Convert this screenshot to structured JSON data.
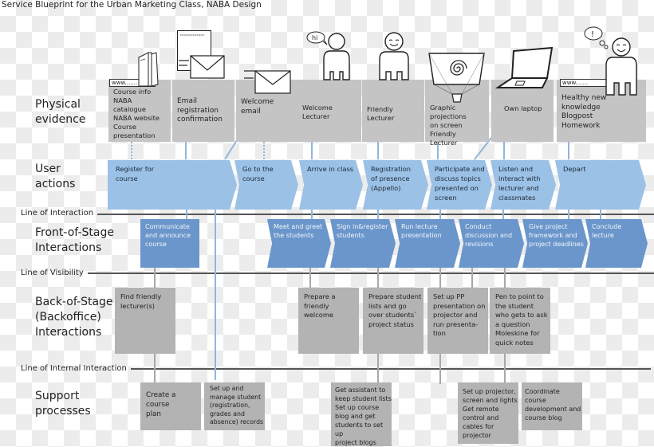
{
  "title": "Service Blueprint for the Urban Marketing Class, NABA Design",
  "lanes": {
    "physical_evidence": "Physical\nevidence",
    "user_actions": "User\nactions",
    "front_stage": "Front-of-Stage\nInteractions",
    "back_stage": "Back-of-Stage\n(Backoffice)\nInteractions",
    "support": "Support\nprocesses"
  },
  "lines": {
    "interaction": "Line of Interaction",
    "visibility": "Line of Visibility",
    "internal": "Line of Internal Interaction"
  },
  "physical_evidence": [
    {
      "text": "Course info\nNABA catalogue\nNABA website\nCourse\npresentation",
      "icon": "brochure-www-icon"
    },
    {
      "text": "Email\nregistration\nconfirmation",
      "icon": "letter-envelope-icon"
    },
    {
      "text": "Welcome\nemail",
      "icon": "envelope-icon"
    },
    {
      "text": "Welcome Lecturer",
      "icon": "person-hi-icon"
    },
    {
      "text": "Friendly Lecturer",
      "icon": "smiling-person-icon"
    },
    {
      "text": "Graphic projections\non screen\nFriendly Lecturer",
      "icon": "projector-spiral-icon"
    },
    {
      "text": "Own laptop",
      "icon": "laptop-icon"
    },
    {
      "text": "Healthy new\nknowledge\nBlogpost\nHomework",
      "icon": "thinking-person-icon"
    }
  ],
  "icon_text": {
    "www": "www.......",
    "hi": "hi",
    "exclaim": "!",
    "letter_header": "abcdefghijklmnopqrstuvwxyz"
  },
  "user_actions": [
    "Register for\ncourse",
    "Go to the\ncourse",
    "Arrive in class",
    "Registration\nof presence\n(Appello)",
    "Participate and\ndiscuss topics\npresented on\nscreen",
    "Listen and\ninteract with\nlecturer and\nclassmates",
    "Depart"
  ],
  "front_stage": [
    "Communicate\nand announce\ncourse",
    "Meet and greet\nthe students",
    "Sign in&register\nstudents",
    "Run lecture\npresentation",
    "Conduct\ndiscussion and\nrevisions",
    "Give project\nframework and\nproject deadlines",
    "Conclude\nlecture"
  ],
  "back_stage": [
    "Find friendly\nlecturer(s)",
    "Prepare a\nfriendly\nwelcome",
    "Prepare student\nlists and go\nover students`\nproject status",
    "Set up PP\npresentation on\nprojector and\nrun presenta-\ntion",
    "Pen to point to\nthe student\nwho gets to ask\na question\nMoleskine for\nquick notes"
  ],
  "support": [
    "Create a course\nplan",
    "Set up and\nmanage student\n(registration,\ngrades and\nabsence) records",
    "Get assistant to\nkeep student lists\nSet up course\nblog and get\nstudents to set up\nproject blogs",
    "Set up projector,\nscreen and lights\nGet remote\ncontrol and\ncables for\nprojector",
    "Coordinate\ncourse\ndevelopment and\ncourse blog"
  ],
  "colors": {
    "user_action": "#9bc1e6",
    "front_stage": "#6b96cb",
    "evidence": "#c4c4c4",
    "back_stage": "#b3b3b3",
    "line": "#555555"
  }
}
